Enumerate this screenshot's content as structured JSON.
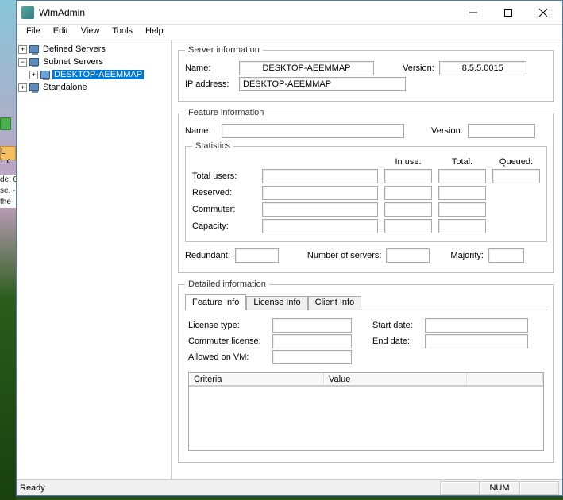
{
  "window": {
    "title": "WlmAdmin"
  },
  "menu": [
    "File",
    "Edit",
    "View",
    "Tools",
    "Help"
  ],
  "tree": {
    "defined": "Defined Servers",
    "subnet": "Subnet Servers",
    "selected": "DESKTOP-AEEMMAP",
    "standalone": "Standalone"
  },
  "server_info": {
    "legend": "Server information",
    "name_lbl": "Name:",
    "name": "DESKTOP-AEEMMAP",
    "version_lbl": "Version:",
    "version": "8.5.5.0015",
    "ip_lbl": "IP address:",
    "ip": "DESKTOP-AEEMMAP"
  },
  "feature_info": {
    "legend": "Feature information",
    "name_lbl": "Name:",
    "name": "",
    "version_lbl": "Version:",
    "version": "",
    "stats_legend": "Statistics",
    "hdr_inuse": "In use:",
    "hdr_total": "Total:",
    "hdr_queued": "Queued:",
    "row_total_users": "Total users:",
    "row_reserved": "Reserved:",
    "row_commuter": "Commuter:",
    "row_capacity": "Capacity:",
    "redundant_lbl": "Redundant:",
    "numservers_lbl": "Number of servers:",
    "majority_lbl": "Majority:"
  },
  "detailed": {
    "legend": "Detailed information",
    "tabs": [
      "Feature Info",
      "License Info",
      "Client Info"
    ],
    "license_type_lbl": "License type:",
    "commuter_lic_lbl": "Commuter license:",
    "allowed_vm_lbl": "Allowed on VM:",
    "start_date_lbl": "Start date:",
    "end_date_lbl": "End date:",
    "col_criteria": "Criteria",
    "col_value": "Value"
  },
  "status": {
    "ready": "Ready",
    "num": "NUM"
  },
  "bg": {
    "lic": "L Lic",
    "de0": "de: 0",
    "se": "se. -",
    "the": " the"
  }
}
